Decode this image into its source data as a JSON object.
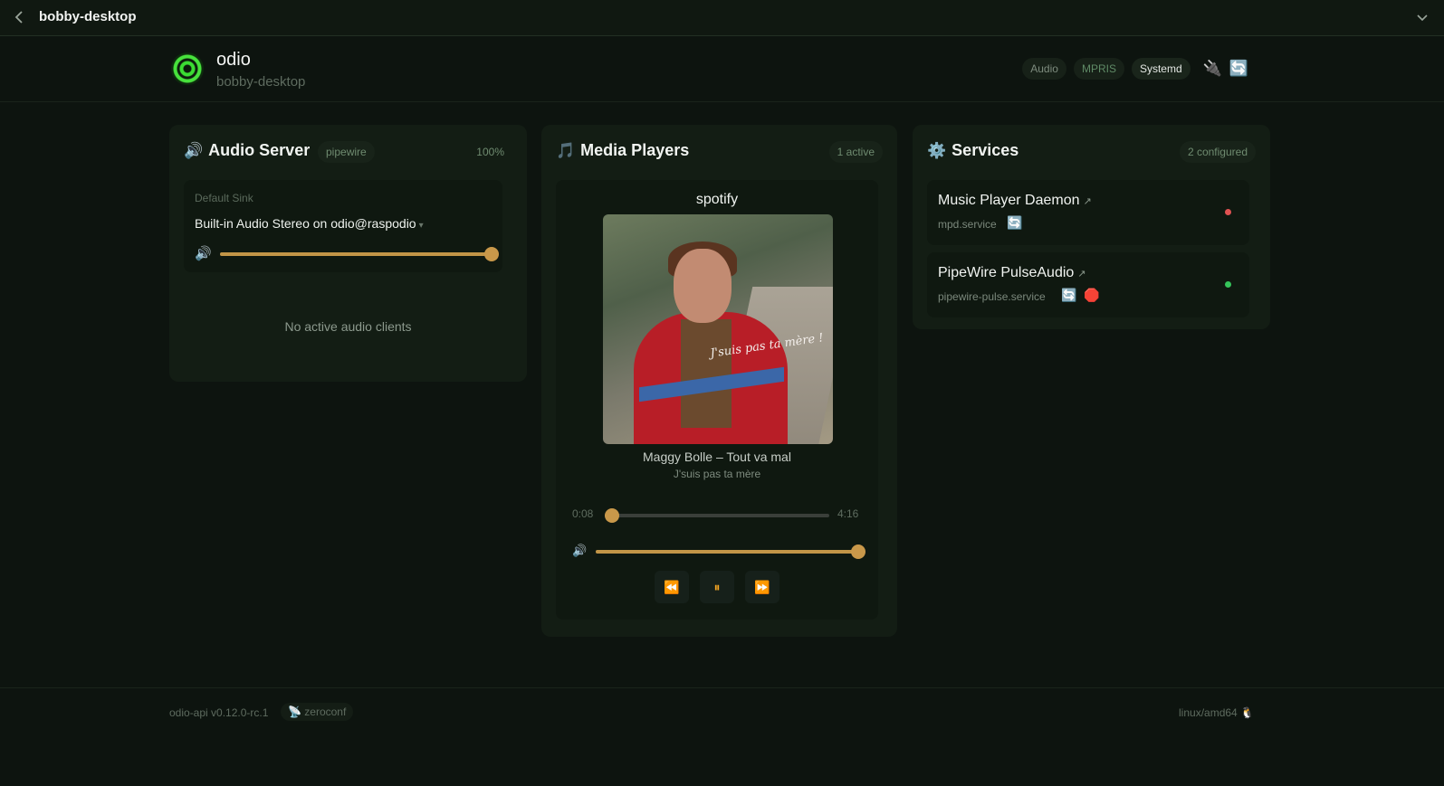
{
  "topbar": {
    "title": "bobby-desktop"
  },
  "header": {
    "app_name": "odio",
    "host": "bobby-desktop",
    "tabs": [
      "Audio",
      "MPRIS",
      "Systemd"
    ],
    "icons": [
      "plug-icon",
      "refresh-icon"
    ],
    "plug_glyph": "🔌",
    "refresh_glyph": "🔄"
  },
  "audio": {
    "icon": "🔊",
    "title": "Audio Server",
    "backend": "pipewire",
    "volume_label": "100%",
    "sink_label": "Default Sink",
    "sink_name": "Built-in Audio Stereo on odio@raspodio",
    "sink_volume": 1.0,
    "empty_text": "No active audio clients"
  },
  "media": {
    "icon": "🎵",
    "title": "Media Players",
    "count": "1 active",
    "player": {
      "name": "spotify",
      "art_text": "J'suis pas ta mère !",
      "track": "Maggy Bolle – Tout va mal",
      "album": "J'suis pas ta mère",
      "position": "0:08",
      "duration": "4:16",
      "progress": 0.031,
      "volume": 1.0,
      "controls": [
        "⏪",
        "⏸",
        "⏩"
      ]
    }
  },
  "services": {
    "icon": "⚙️",
    "title": "Services",
    "count": "2 configured",
    "items": [
      {
        "name": "Music Player Daemon",
        "unit": "mpd.service",
        "status_color": "#e05252"
      },
      {
        "name": "PipeWire PulseAudio",
        "unit": "pipewire-pulse.service",
        "status_color": "#35c45a"
      }
    ],
    "restart_glyph": "🔄",
    "stop_glyph": "🛑"
  },
  "footer": {
    "version": "odio-api v0.12.0-rc.1",
    "discovery": "📡 zeroconf",
    "platform": "linux/amd64 🐧"
  }
}
